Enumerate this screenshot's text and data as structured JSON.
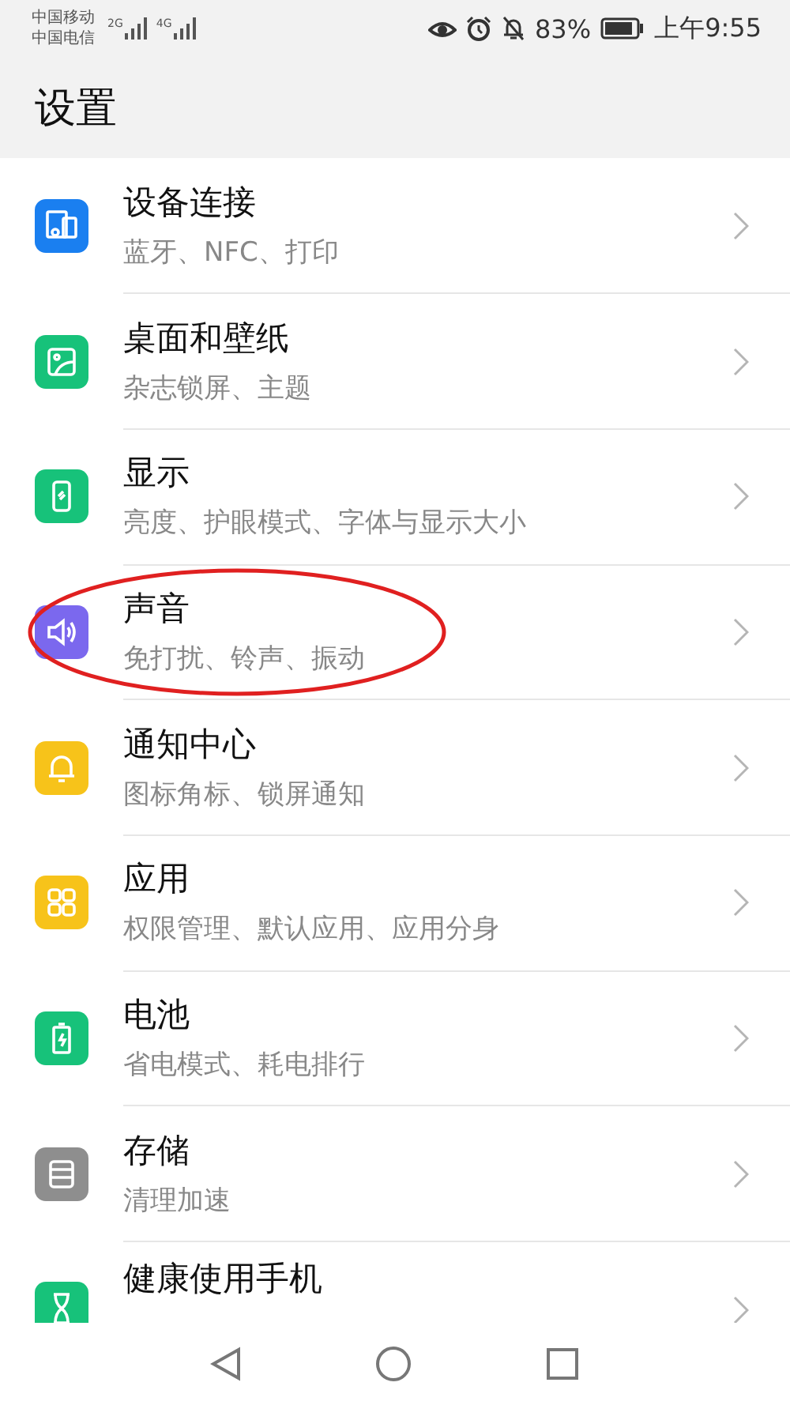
{
  "status_bar": {
    "carriers": [
      "中国移动",
      "中国电信"
    ],
    "networks": [
      "2G",
      "4G"
    ],
    "battery": "83%",
    "time": "上午9:55"
  },
  "title": "设置",
  "items": [
    {
      "title": "设备连接",
      "subtitle": "蓝牙、NFC、打印",
      "kind": "devices",
      "color": "#1a7ff0",
      "circled": false
    },
    {
      "title": "桌面和壁纸",
      "subtitle": "杂志锁屏、主题",
      "kind": "picture",
      "color": "#17c27a",
      "circled": false
    },
    {
      "title": "显示",
      "subtitle": "亮度、护眼模式、字体与显示大小",
      "kind": "phone",
      "color": "#17c27a",
      "circled": false
    },
    {
      "title": "声音",
      "subtitle": "免打扰、铃声、振动",
      "kind": "speaker",
      "color": "#7b68ee",
      "circled": true
    },
    {
      "title": "通知中心",
      "subtitle": "图标角标、锁屏通知",
      "kind": "bell",
      "color": "#f7c31a",
      "circled": false
    },
    {
      "title": "应用",
      "subtitle": "权限管理、默认应用、应用分身",
      "kind": "grid",
      "color": "#f7c31a",
      "circled": false
    },
    {
      "title": "电池",
      "subtitle": "省电模式、耗电排行",
      "kind": "battery",
      "color": "#17c27a",
      "circled": false
    },
    {
      "title": "存储",
      "subtitle": "清理加速",
      "kind": "storage",
      "color": "#8e8e8e",
      "circled": false
    },
    {
      "title": "健康使用手机",
      "kind": "hourglass",
      "color": "#17c27a",
      "circled": false
    }
  ]
}
